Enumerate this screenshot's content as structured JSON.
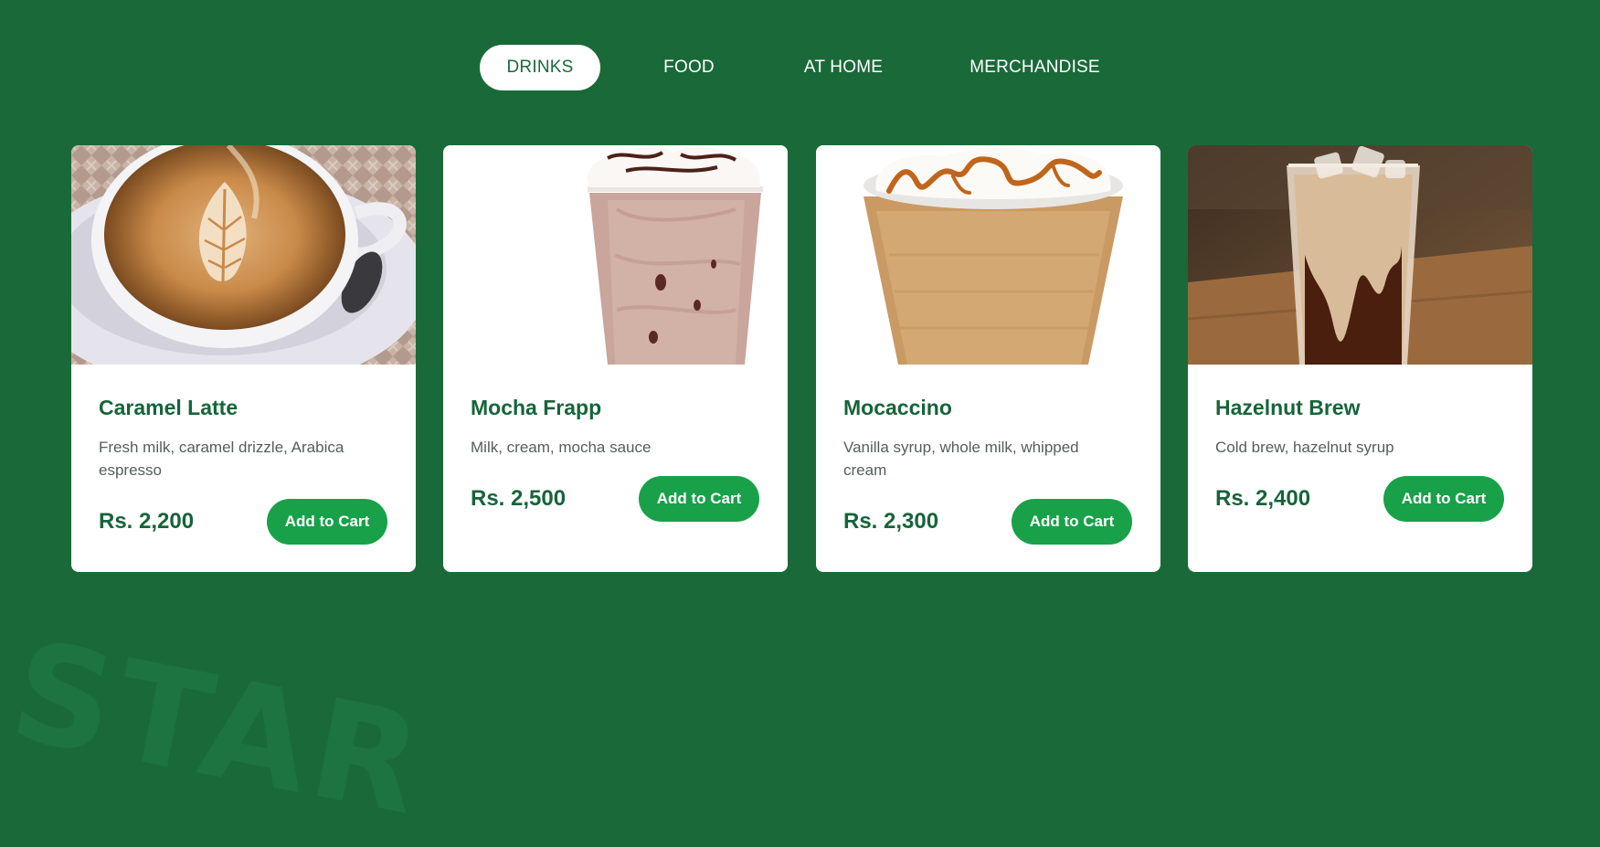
{
  "watermark": "STAR",
  "tabs": [
    {
      "label": "DRINKS",
      "active": true
    },
    {
      "label": "FOOD",
      "active": false
    },
    {
      "label": "AT HOME",
      "active": false
    },
    {
      "label": "MERCHANDISE",
      "active": false
    }
  ],
  "products": [
    {
      "name": "Caramel Latte",
      "description": "Fresh milk, caramel drizzle, Arabica espresso",
      "price": "Rs. 2,200",
      "button": "Add to Cart",
      "image": "caramel-latte-photo"
    },
    {
      "name": "Mocha Frapp",
      "description": "Milk, cream, mocha sauce",
      "price": "Rs. 2,500",
      "button": "Add to Cart",
      "image": "mocha-frapp-photo"
    },
    {
      "name": "Mocaccino",
      "description": "Vanilla syrup, whole milk, whipped cream",
      "price": "Rs. 2,300",
      "button": "Add to Cart",
      "image": "mocaccino-photo"
    },
    {
      "name": "Hazelnut Brew",
      "description": "Cold brew, hazelnut syrup",
      "price": "Rs. 2,400",
      "button": "Add to Cart",
      "image": "hazelnut-brew-photo"
    }
  ],
  "colors": {
    "background": "#1a6a39",
    "accent": "#18a149",
    "title": "#17643a",
    "card": "#ffffff"
  }
}
